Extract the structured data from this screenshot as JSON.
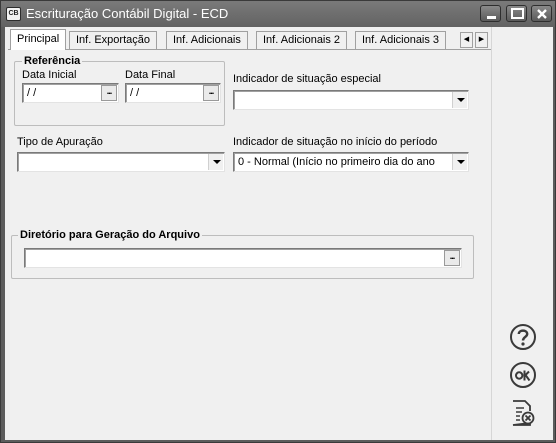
{
  "window": {
    "title": "Escrituração Contábil Digital - ECD",
    "icon_text": "CB",
    "controls": [
      "minimize-icon",
      "maximize-icon",
      "close-icon"
    ]
  },
  "tabs": [
    {
      "label": "Principal",
      "active": true
    },
    {
      "label": "Inf. Exportação",
      "active": false
    },
    {
      "label": "Inf. Adicionais",
      "active": false
    },
    {
      "label": "Inf. Adicionais 2",
      "active": false
    },
    {
      "label": "Inf. Adicionais 3",
      "active": false
    }
  ],
  "tab_scroll": {
    "left": "◀",
    "right": "▶"
  },
  "referencia": {
    "title": "Referência",
    "data_inicial_label": "Data Inicial",
    "data_inicial_value": " / /",
    "data_final_label": "Data Final",
    "data_final_value": " / /",
    "ellipsis": "..."
  },
  "indicador_situacao_especial": {
    "label": "Indicador de situação especial",
    "value": ""
  },
  "tipo_apuracao": {
    "label": "Tipo de Apuração",
    "value": ""
  },
  "indicador_situacao_inicio": {
    "label": "Indicador de situação no início do período",
    "value": "0 - Normal (Início no primeiro dia do ano ou d"
  },
  "diretorio": {
    "title": "Diretório para Geração do Arquivo",
    "value": "",
    "ellipsis": "..."
  },
  "side_buttons": [
    "help-icon",
    "ok-icon",
    "cancel-icon"
  ]
}
